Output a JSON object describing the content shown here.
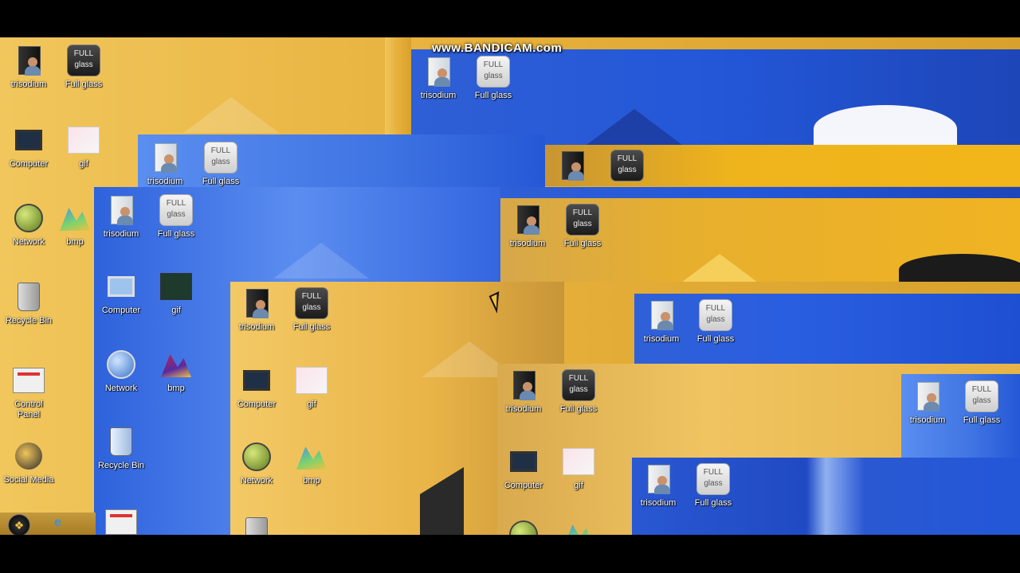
{
  "watermark": "www.BANDICAM.com",
  "colors": {
    "gold": "#e7b23a",
    "blue": "#2357d8",
    "black": "#000000"
  },
  "desktop_icons": [
    {
      "label": "trisodium",
      "icon": "user-icon"
    },
    {
      "label": "Full glass",
      "icon": "full-glass-icon",
      "text_top": "FULL",
      "text_bottom": "glass"
    },
    {
      "label": "Computer",
      "icon": "computer-icon"
    },
    {
      "label": "gif",
      "icon": "gif-icon"
    },
    {
      "label": "Network",
      "icon": "network-icon"
    },
    {
      "label": "bmp",
      "icon": "bmp-icon"
    },
    {
      "label": "Recycle Bin",
      "icon": "recycle-bin-icon"
    },
    {
      "label": "Control Panel",
      "icon": "control-panel-icon"
    },
    {
      "label": "Social Media",
      "icon": "social-media-icon"
    }
  ],
  "fg": {
    "top": "FULL",
    "bottom": "glass"
  },
  "labels": {
    "trisodium": "trisodium",
    "fullglass": "Full glass",
    "computer": "Computer",
    "gif": "gif",
    "network": "Network",
    "bmp": "bmp",
    "bmp_cut": "bmp",
    "recycle": "Recycle Bin",
    "control_line1": "Control",
    "control_line2": "Panel",
    "social": "Social Media"
  },
  "taskbar": {
    "start_icon": "windows-orb-icon",
    "browser_icon": "internet-explorer-icon",
    "ie_glyph": "e",
    "start_glyph": "❖"
  }
}
